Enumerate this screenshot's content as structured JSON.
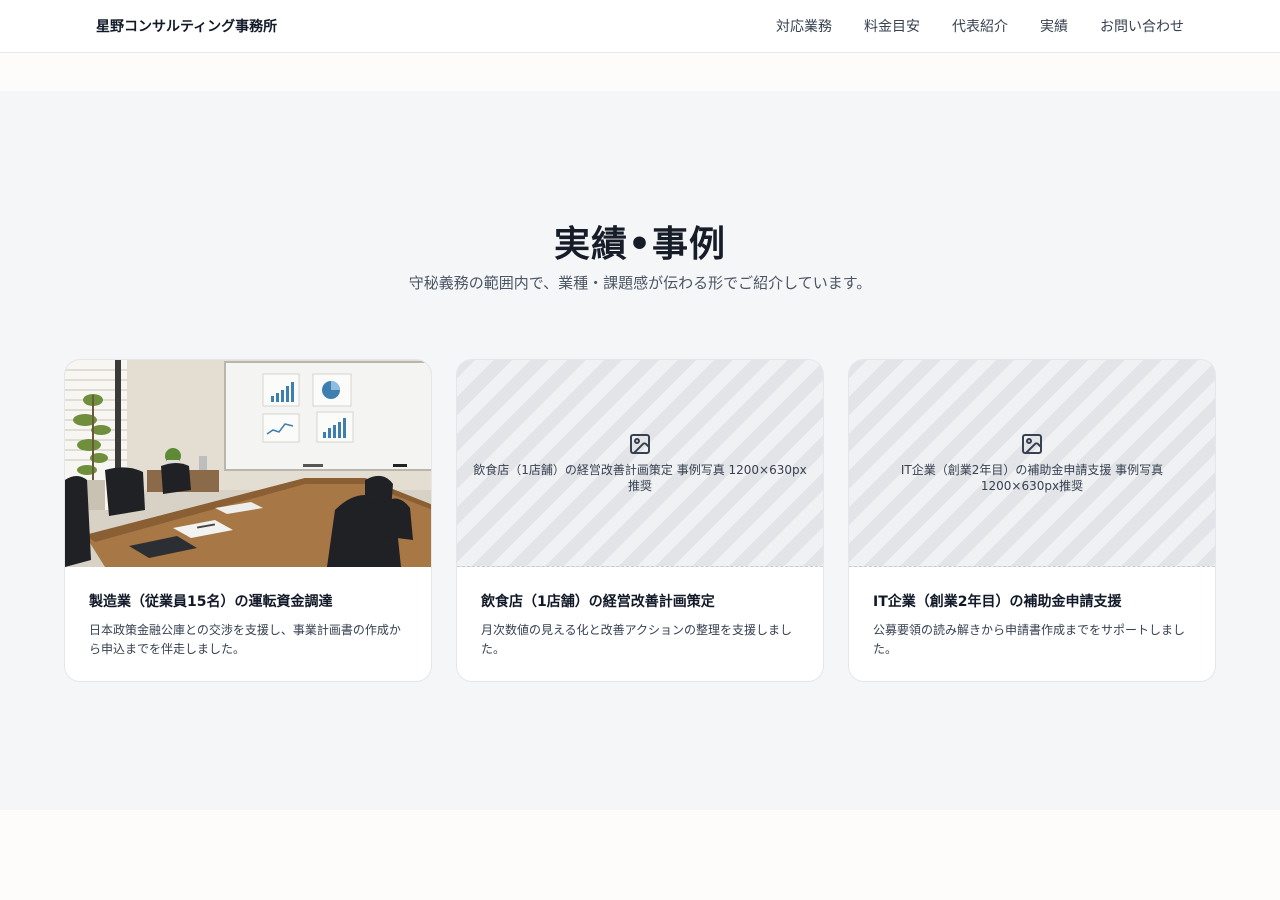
{
  "header": {
    "logo": "星野コンサルティング事務所",
    "nav": [
      "対応業務",
      "料金目安",
      "代表紹介",
      "実績",
      "お問い合わせ"
    ]
  },
  "section": {
    "title": "実績•事例",
    "subtitle": "守秘義務の範囲内で、業種・課題感が伝わる形でご紹介しています。"
  },
  "cases": [
    {
      "title": "製造業（従業員15名）の運転資金調達",
      "text": "日本政策金融公庫との交渉を支援し、事業計画書の作成から申込までを伴走しました。",
      "image": "meeting-room-photo"
    },
    {
      "title": "飲食店（1店舗）の経営改善計画策定",
      "text": "月次数値の見える化と改善アクションの整理を支援しました。",
      "image_placeholder": "飲食店（1店舗）の経営改善計画策定 事例写真 1200×630px推奨"
    },
    {
      "title": "IT企業（創業2年目）の補助金申請支援",
      "text": "公募要領の読み解きから申請書作成までをサポートしました。",
      "image_placeholder": "IT企業（創業2年目）の補助金申請支援 事例写真 1200×630px推奨"
    }
  ],
  "colors": {
    "page_bg": "#fdfcfa",
    "section_bg": "#f5f6f8",
    "text_primary": "#111827",
    "text_secondary": "#4b5563"
  }
}
